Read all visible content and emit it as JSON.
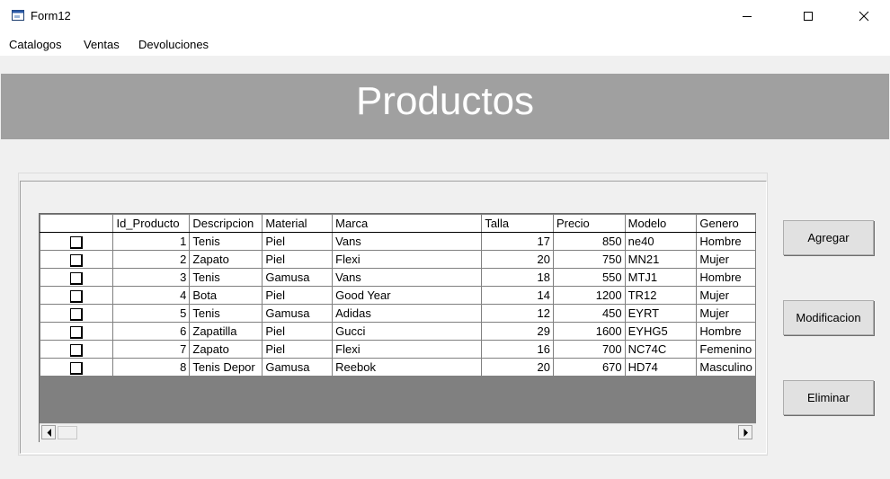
{
  "window": {
    "title": "Form12"
  },
  "menu": [
    {
      "label": "Catalogos"
    },
    {
      "label": "Ventas"
    },
    {
      "label": "Devoluciones"
    }
  ],
  "heading": "Productos",
  "table": {
    "columns": [
      "Id_Producto",
      "Descripcion",
      "Material",
      "Marca",
      "Talla",
      "Precio",
      "Modelo",
      "Genero"
    ],
    "rows": [
      {
        "id": "1",
        "descripcion": "Tenis",
        "material": "Piel",
        "marca": "Vans",
        "talla": "17",
        "precio": "850",
        "modelo": "ne40",
        "genero": "Hombre"
      },
      {
        "id": "2",
        "descripcion": "Zapato",
        "material": "Piel",
        "marca": "Flexi",
        "talla": "20",
        "precio": "750",
        "modelo": "MN21",
        "genero": "Mujer"
      },
      {
        "id": "3",
        "descripcion": "Tenis",
        "material": "Gamusa",
        "marca": "Vans",
        "talla": "18",
        "precio": "550",
        "modelo": "MTJ1",
        "genero": "Hombre"
      },
      {
        "id": "4",
        "descripcion": "Bota",
        "material": "Piel",
        "marca": "Good Year",
        "talla": "14",
        "precio": "1200",
        "modelo": "TR12",
        "genero": "Mujer"
      },
      {
        "id": "5",
        "descripcion": "Tenis",
        "material": "Gamusa",
        "marca": "Adidas",
        "talla": "12",
        "precio": "450",
        "modelo": "EYRT",
        "genero": "Mujer"
      },
      {
        "id": "6",
        "descripcion": "Zapatilla",
        "material": "Piel",
        "marca": "Gucci",
        "talla": "29",
        "precio": "1600",
        "modelo": "EYHG5",
        "genero": "Hombre"
      },
      {
        "id": "7",
        "descripcion": "Zapato",
        "material": "Piel",
        "marca": "Flexi",
        "talla": "16",
        "precio": "700",
        "modelo": "NC74C",
        "genero": "Femenino"
      },
      {
        "id": "8",
        "descripcion": "Tenis Depor",
        "material": "Gamusa",
        "marca": "Reebok",
        "talla": "20",
        "precio": "670",
        "modelo": "HD74",
        "genero": "Masculino"
      }
    ]
  },
  "buttons": {
    "agregar": "Agregar",
    "modificacion": "Modificacion",
    "eliminar": "Eliminar"
  },
  "icons": {
    "app": "form-icon",
    "minimize": "minimize-icon",
    "maximize": "maximize-icon",
    "close": "close-icon",
    "scroll_left": "arrow-left-icon",
    "scroll_right": "arrow-right-icon",
    "checkbox": "checkbox-icon"
  }
}
